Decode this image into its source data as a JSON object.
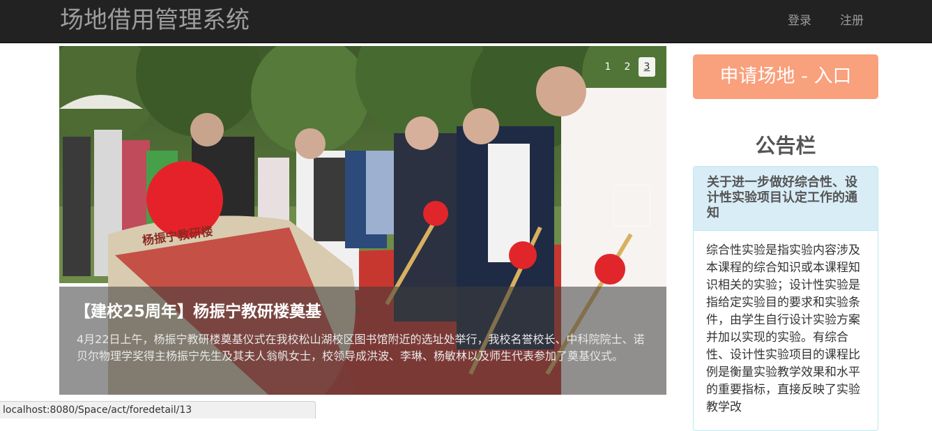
{
  "navbar": {
    "brand": "场地借用管理系统",
    "login": "登录",
    "register": "注册"
  },
  "carousel": {
    "indicators": [
      "1",
      "2",
      "3"
    ],
    "active_index": 3,
    "caption_title": "【建校25周年】杨振宁教研楼奠基",
    "caption_text": "4月22日上午，杨振宁教研楼奠基仪式在我校松山湖校区图书馆附近的选址处举行，我校名誉校长、中科院院士、诺贝尔物理学奖得主杨振宁先生及其夫人翁帆女士，校领导成洪波、李琳、杨敏林以及师生代表参加了奠基仪式。",
    "photo_stone_text": "杨振宁教研楼"
  },
  "sidebar": {
    "apply_button": "申请场地 - 入口",
    "board_title": "公告栏",
    "notice": {
      "title": "关于进一步做好综合性、设计性实验项目认定工作的通知",
      "body": "综合性实验是指实验内容涉及本课程的综合知识或本课程知识相关的实验；设计性实验是指给定实验目的要求和实验条件，由学生自行设计实验方案并加以实现的实验。有综合性、设计性实验项目的课程比例是衡量实验教学效果和水平的重要指标，直接反映了实验教学改"
    }
  },
  "status_bar": {
    "url": "localhost:8080/Space/act/foredetail/13"
  },
  "colors": {
    "navbar_bg": "#222222",
    "nav_text": "#9d9d9d",
    "apply_button_bg": "#f9a07c",
    "panel_heading_bg": "#d9edf7",
    "panel_border": "#bce8f1"
  }
}
